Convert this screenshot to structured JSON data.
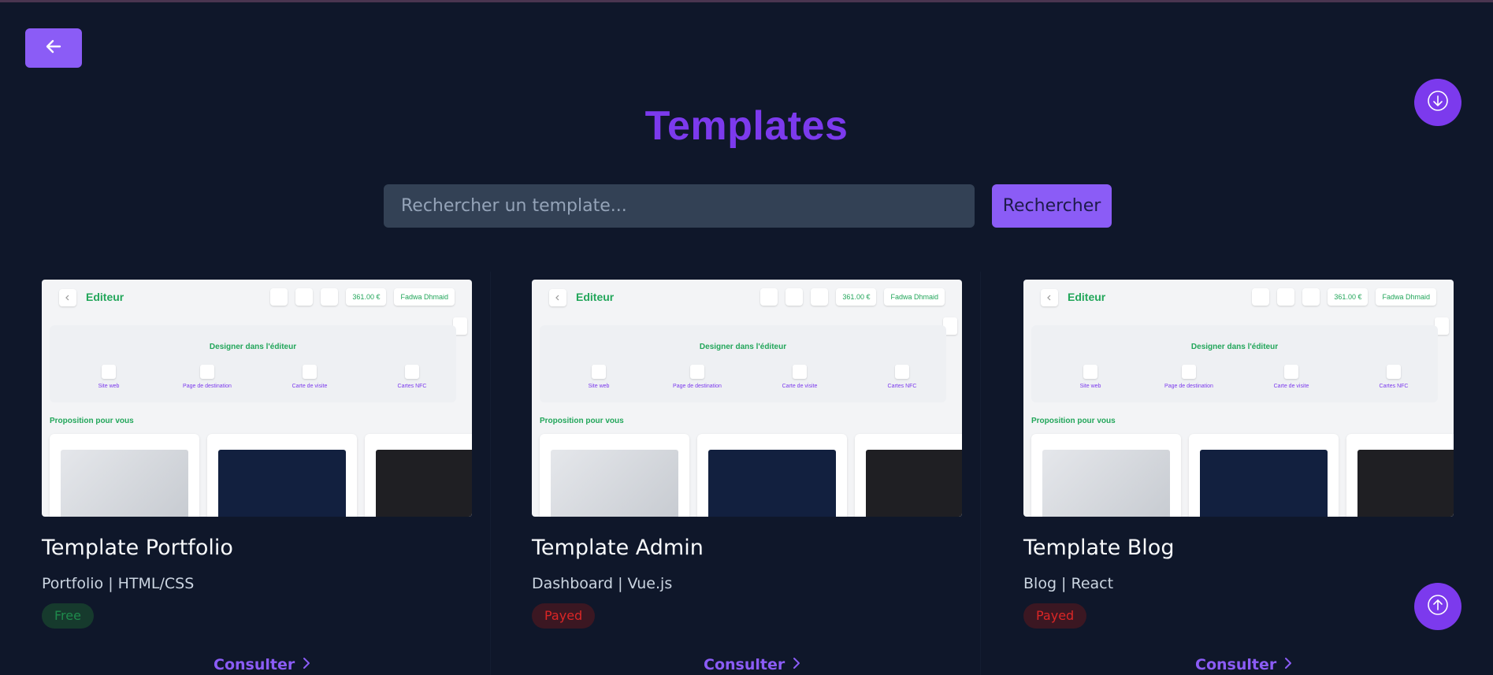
{
  "page": {
    "title": "Templates",
    "back_icon": "arrow-left-icon",
    "scroll_down_icon": "arrow-down-circle-icon",
    "scroll_up_icon": "arrow-up-circle-icon",
    "accent_color": "#8b5cf6",
    "background_color": "#0f172a"
  },
  "search": {
    "placeholder": "Rechercher un template...",
    "value": "",
    "button_label": "Rechercher"
  },
  "templates": [
    {
      "name": "Template Portfolio",
      "meta": "Portfolio | HTML/CSS",
      "badge": "Free",
      "badge_status": "free",
      "action_label": "Consulter"
    },
    {
      "name": "Template Admin",
      "meta": "Dashboard | Vue.js",
      "badge": "Payed",
      "badge_status": "paid",
      "action_label": "Consulter"
    },
    {
      "name": "Template Blog",
      "meta": "Blog | React",
      "badge": "Payed",
      "badge_status": "paid",
      "action_label": "Consulter"
    }
  ],
  "preview": {
    "title": "Editeur",
    "balance": "361.00 €",
    "user": "Fadwa Dhmaid",
    "panel_title": "Designer dans l'éditeur",
    "tiles": [
      "Site web",
      "Page de destination",
      "Carte de visite",
      "Cartes NFC"
    ],
    "section_title": "Proposition pour vous"
  }
}
